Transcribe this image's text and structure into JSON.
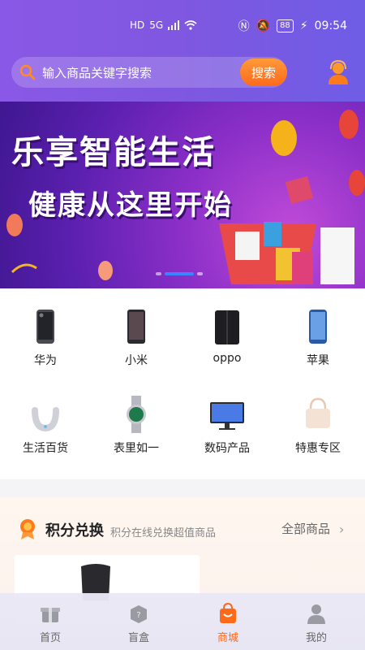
{
  "status_bar": {
    "left_indicators": [
      "HD",
      "5G"
    ],
    "battery": "88",
    "time": "09:54"
  },
  "search": {
    "placeholder": "输入商品关键字搜索",
    "button_label": "搜索"
  },
  "banner": {
    "line1": "乐享智能生活",
    "line2": "健康从这里开始",
    "dots": 3,
    "active_dot": 1
  },
  "categories": [
    {
      "label": "华为",
      "icon": "phone-icon"
    },
    {
      "label": "小米",
      "icon": "phone-icon"
    },
    {
      "label": "oppo",
      "icon": "foldable-phone-icon"
    },
    {
      "label": "苹果",
      "icon": "phone-icon"
    },
    {
      "label": "生活百货",
      "icon": "neck-massager-icon"
    },
    {
      "label": "表里如一",
      "icon": "watch-icon"
    },
    {
      "label": "数码产品",
      "icon": "monitor-icon"
    },
    {
      "label": "特惠专区",
      "icon": "handbag-icon"
    }
  ],
  "points": {
    "title": "积分兑换",
    "subtitle": "积分在线兑换超值商品",
    "all_link": "全部商品"
  },
  "nav": [
    {
      "label": "首页",
      "icon": "home-gift-icon"
    },
    {
      "label": "盲盒",
      "icon": "blind-box-icon"
    },
    {
      "label": "商城",
      "icon": "shopping-bag-icon",
      "active": true
    },
    {
      "label": "我的",
      "icon": "user-icon"
    }
  ],
  "colors": {
    "header": "#8a58e6",
    "accent": "#ff6a1a",
    "dot_active": "#3a85ff"
  }
}
